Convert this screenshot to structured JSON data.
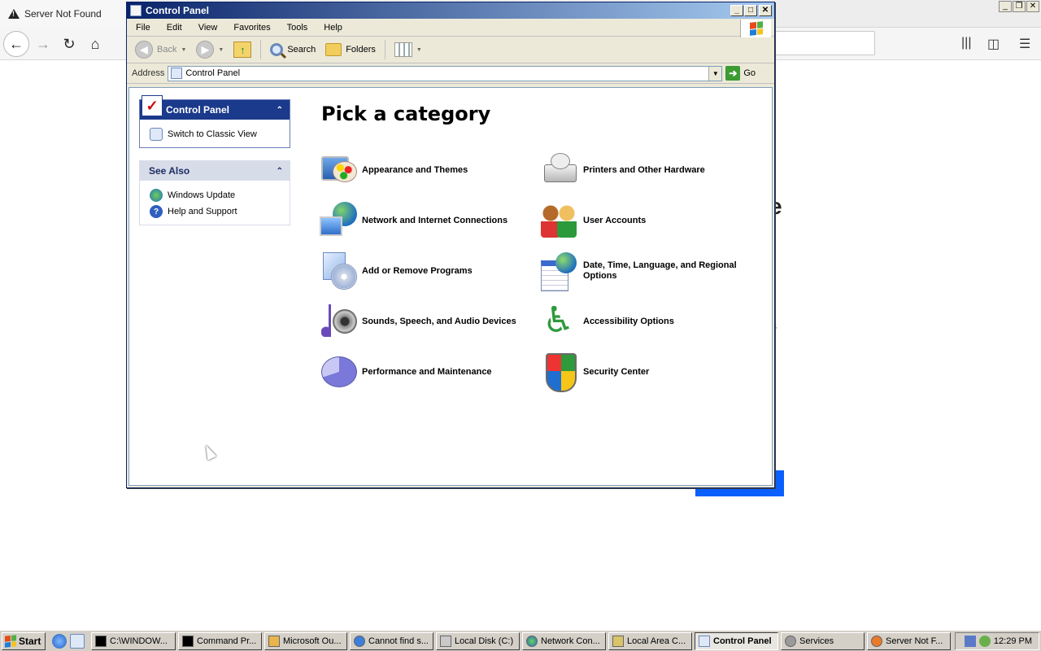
{
  "browser": {
    "tab_title": "Server Not Found",
    "background_heading_fragment": "e",
    "background_text_fragment": "s"
  },
  "cp": {
    "title": "Control Panel",
    "menu": [
      "File",
      "Edit",
      "View",
      "Favorites",
      "Tools",
      "Help"
    ],
    "toolbar": {
      "back_label": "Back",
      "search_label": "Search",
      "folders_label": "Folders"
    },
    "address": {
      "label": "Address",
      "value": "Control Panel",
      "go_label": "Go"
    },
    "left_pane": {
      "control_panel_box": {
        "header": "Control Panel",
        "links": [
          "Switch to Classic View"
        ]
      },
      "see_also_box": {
        "header": "See Also",
        "links": [
          "Windows Update",
          "Help and Support"
        ]
      }
    },
    "page_title": "Pick a category",
    "categories": [
      {
        "label": "Appearance and Themes",
        "icon": "appearance-themes-icon"
      },
      {
        "label": "Printers and Other Hardware",
        "icon": "printer-hardware-icon"
      },
      {
        "label": "Network and Internet Connections",
        "icon": "network-internet-icon"
      },
      {
        "label": "User Accounts",
        "icon": "user-accounts-icon"
      },
      {
        "label": "Add or Remove Programs",
        "icon": "add-remove-programs-icon"
      },
      {
        "label": "Date, Time, Language, and Regional Options",
        "icon": "date-time-language-icon"
      },
      {
        "label": "Sounds, Speech, and Audio Devices",
        "icon": "sounds-audio-icon"
      },
      {
        "label": "Accessibility Options",
        "icon": "accessibility-icon"
      },
      {
        "label": "Performance and Maintenance",
        "icon": "performance-maintenance-icon"
      },
      {
        "label": "Security Center",
        "icon": "security-center-shield-icon"
      }
    ]
  },
  "taskbar": {
    "start_label": "Start",
    "buttons": [
      {
        "label": "C:\\WINDOW...",
        "icon": "cmd-icon",
        "active": false
      },
      {
        "label": "Command Pr...",
        "icon": "cmd-icon",
        "active": false
      },
      {
        "label": "Microsoft Ou...",
        "icon": "outlook-icon",
        "active": false
      },
      {
        "label": "Cannot find s...",
        "icon": "ie-icon",
        "active": false
      },
      {
        "label": "Local Disk (C:)",
        "icon": "disk-icon",
        "active": false
      },
      {
        "label": "Network Con...",
        "icon": "network-icon",
        "active": false
      },
      {
        "label": "Local Area C...",
        "icon": "lan-icon",
        "active": false
      },
      {
        "label": "Control Panel",
        "icon": "control-panel-icon",
        "active": true
      },
      {
        "label": "Services",
        "icon": "services-gear-icon",
        "active": false
      },
      {
        "label": "Server Not F...",
        "icon": "firefox-icon",
        "active": false
      }
    ],
    "clock": "12:29 PM"
  },
  "colors": {
    "xp_titlebar": "#0a246a",
    "task_header_blue": "#1b3a8c",
    "firefox_button_blue": "#0a60ff"
  }
}
